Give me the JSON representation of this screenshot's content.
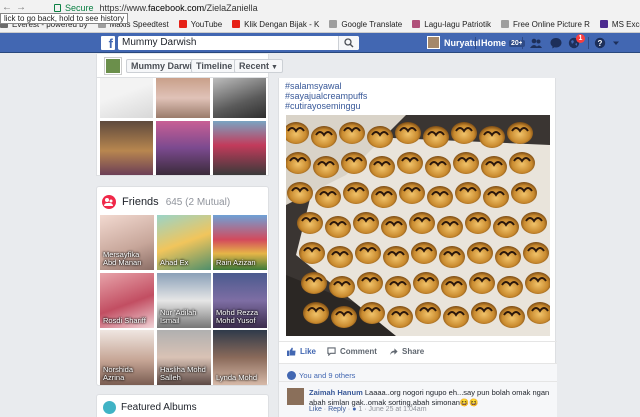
{
  "browser": {
    "secure_label": "Secure",
    "url_prefix": "https://www.",
    "url_domain": "facebook.com",
    "url_path": "/ZielaZaniella",
    "tooltip": "lick to go back, hold to see history",
    "bookmarks": [
      {
        "label": "Everest - powered by",
        "icon": "everest-icon",
        "color": "#6a6a6a"
      },
      {
        "label": "Maxis Speedtest",
        "icon": "page-icon",
        "color": "#9e9e9e"
      },
      {
        "label": "YouTube",
        "icon": "youtube-icon",
        "color": "#e62117"
      },
      {
        "label": "Klik Dengan Bijak - K",
        "icon": "youtube-icon",
        "color": "#e62117"
      },
      {
        "label": "Google Translate",
        "icon": "page-icon",
        "color": "#9e9e9e"
      },
      {
        "label": "Lagu-lagu Patriotik",
        "icon": "music-icon",
        "color": "#b0507a"
      },
      {
        "label": "Free Online Picture R",
        "icon": "page-icon",
        "color": "#9e9e9e"
      },
      {
        "label": "MS Exce",
        "icon": "ms-icon",
        "color": "#4b2a8f"
      }
    ]
  },
  "header": {
    "logo": "f",
    "search_value": "Mummy Darwish",
    "user_name": "Nuryatul",
    "home_label": "Home",
    "home_count": "20+",
    "notification_count": "1",
    "colors": {
      "bar": "#4267b2",
      "badge": "#fa3e3e"
    }
  },
  "timeline_nav": {
    "name_button": "Mummy Darwish",
    "timeline_button": "Timeline",
    "recent_button": "Recent"
  },
  "friends": {
    "title": "Friends",
    "count": "645 (2 Mutual)",
    "tiles": [
      {
        "name": "Mersayfika Abd Manan"
      },
      {
        "name": "Ahad Ex"
      },
      {
        "name": "Rain Azizan"
      },
      {
        "name": "Rosdi Shariff"
      },
      {
        "name": "Nur 'Adilah Ismail"
      },
      {
        "name": "Mohd Rezza Mohd Yusof"
      },
      {
        "name": "Norshida Azrina"
      },
      {
        "name": "Hasliha Mohd Salleh"
      },
      {
        "name": "Lynda Mohd"
      }
    ]
  },
  "albums": {
    "title": "Featured Albums"
  },
  "post": {
    "tags": [
      "#salamsyawal",
      "#sayajualcreampuffs",
      "#cutirayoseminggu"
    ],
    "actions": {
      "like": "Like",
      "comment": "Comment",
      "share": "Share"
    },
    "reactions": "You and 9 others",
    "comment": {
      "author": "Zaimah Hanum",
      "text": "Laaaa..org nogori ngupo eh...say pun bolah omak ngan abah simlan gak..omak sorting,abah simonan",
      "emoji": "😆😆",
      "like": "Like",
      "reply": "Reply",
      "count": "1",
      "date": "June 25 at 1:04am"
    }
  }
}
